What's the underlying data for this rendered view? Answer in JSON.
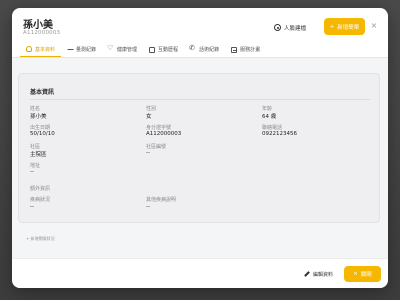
{
  "patient": {
    "name": "孫小美",
    "id_number": "A112000003"
  },
  "header": {
    "face_button_label": "人臉建檔",
    "add_button_label": "新增簡單",
    "close_glyph": "×"
  },
  "tabs": [
    {
      "label": "基本資料",
      "active": true,
      "icon": "user-icon"
    },
    {
      "label": "量測紀錄",
      "active": false,
      "icon": "pulse-icon"
    },
    {
      "label": "健康管理",
      "active": false,
      "icon": "heart-icon"
    },
    {
      "label": "互動歷程",
      "active": false,
      "icon": "document-icon"
    },
    {
      "label": "話術紀錄",
      "active": false,
      "icon": "phone-icon"
    },
    {
      "label": "服務計畫",
      "active": false,
      "icon": "sheet-icon"
    }
  ],
  "basic_info": {
    "section_title": "基本資訊",
    "fields": {
      "name": {
        "label": "姓名",
        "value": "孫小美"
      },
      "gender": {
        "label": "性別",
        "value": "女"
      },
      "age": {
        "label": "年齡",
        "value": "64 歲"
      },
      "birth": {
        "label": "出生日期",
        "value": "50/10/10"
      },
      "id": {
        "label": "身分證字號",
        "value": "A112000003"
      },
      "phone": {
        "label": "聯絡電話",
        "value": "0922123456"
      },
      "district": {
        "label": "社區",
        "value": "主院區"
      },
      "district_code": {
        "label": "社區編號",
        "value": "--"
      },
      "address": {
        "label": "地址",
        "value": "--"
      }
    },
    "extra_title": "額外資訊",
    "extra": {
      "disease": {
        "label": "疾病狀況",
        "value": "--"
      },
      "other_disease": {
        "label": "其他疾病說明",
        "value": "--"
      }
    }
  },
  "mini_note": "+ 新增關懷狀況",
  "footer": {
    "edit_label": "編輯資料",
    "close_label": "關閉",
    "close_glyph": "×"
  },
  "colors": {
    "accent": "#f5b700",
    "active_tab": "#e0a100"
  }
}
